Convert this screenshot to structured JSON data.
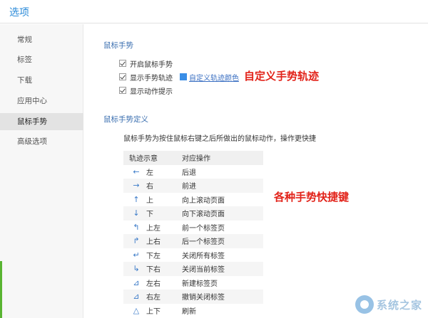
{
  "window": {
    "title": "选项"
  },
  "sidebar": {
    "items": [
      {
        "label": "常规",
        "active": false
      },
      {
        "label": "标签",
        "active": false
      },
      {
        "label": "下载",
        "active": false
      },
      {
        "label": "应用中心",
        "active": false
      },
      {
        "label": "鼠标手势",
        "active": true
      },
      {
        "label": "高级选项",
        "active": false
      }
    ]
  },
  "mouse_gesture": {
    "section_title": "鼠标手势",
    "options": [
      {
        "label": "开启鼠标手势",
        "checked": true
      },
      {
        "label": "显示手势轨迹",
        "checked": true
      },
      {
        "label": "显示动作提示",
        "checked": true
      }
    ],
    "custom_color_link": "自定义轨迹颜色",
    "trail_color": "#3a8ee6"
  },
  "annotations": {
    "custom_trail": "自定义手势轨迹",
    "shortcuts": "各种手势快捷键"
  },
  "gesture_definition": {
    "section_title": "鼠标手势定义",
    "description": "鼠标手势为按住鼠标右键之后所做出的鼠标动作，操作更快捷",
    "table": {
      "headers": [
        "轨迹示意",
        "对应操作"
      ],
      "rows": [
        {
          "icon": "arrow-left-icon",
          "glyph": "←",
          "gesture": "左",
          "action": "后退"
        },
        {
          "icon": "arrow-right-icon",
          "glyph": "→",
          "gesture": "右",
          "action": "前进"
        },
        {
          "icon": "arrow-up-icon",
          "glyph": "↑",
          "gesture": "上",
          "action": "向上滚动页面"
        },
        {
          "icon": "arrow-down-icon",
          "glyph": "↓",
          "gesture": "下",
          "action": "向下滚动页面"
        },
        {
          "icon": "arrow-up-left-icon",
          "glyph": "↰",
          "gesture": "上左",
          "action": "前一个标签页"
        },
        {
          "icon": "arrow-up-right-icon",
          "glyph": "↱",
          "gesture": "上右",
          "action": "后一个标签页"
        },
        {
          "icon": "arrow-down-left-icon",
          "glyph": "↵",
          "gesture": "下左",
          "action": "关闭所有标签"
        },
        {
          "icon": "arrow-down-right-icon",
          "glyph": "↳",
          "gesture": "下右",
          "action": "关闭当前标签"
        },
        {
          "icon": "arrow-left-right-icon",
          "glyph": "⊿",
          "gesture": "左右",
          "action": "新建标签页"
        },
        {
          "icon": "arrow-right-left-icon",
          "glyph": "⊿",
          "gesture": "右左",
          "action": "撤销关闭标签"
        },
        {
          "icon": "arrow-up-down-icon",
          "glyph": "△",
          "gesture": "上下",
          "action": "刷新"
        }
      ]
    }
  },
  "watermark": {
    "text": "系统之家"
  },
  "colors": {
    "accent": "#2a8ad8",
    "annotation": "#e2231a",
    "sidebar_accent": "#59b432"
  }
}
